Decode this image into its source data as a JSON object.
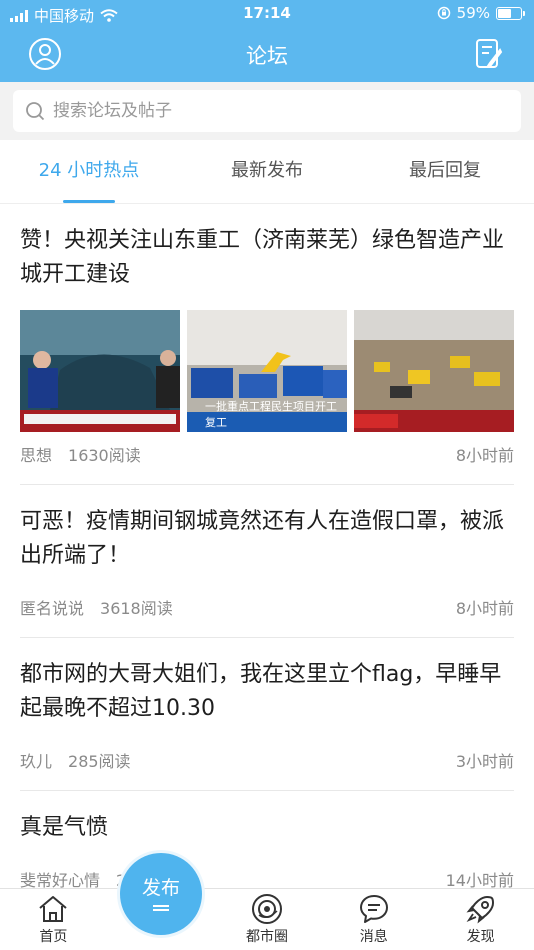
{
  "status": {
    "carrier": "中国移动",
    "time": "17:14",
    "battery": "59%",
    "battery_level": 0.59
  },
  "nav": {
    "title": "论坛",
    "left_icon": "user-circle-icon",
    "right_icon": "compose-icon"
  },
  "search": {
    "placeholder": "搜索论坛及帖子"
  },
  "tabs": [
    {
      "label": "24 小时热点",
      "active": true
    },
    {
      "label": "最新发布",
      "active": false
    },
    {
      "label": "最后回复",
      "active": false
    }
  ],
  "posts": [
    {
      "title": "赞！央视关注山东重工（济南莱芜）绿色智造产业城开工建设",
      "author": "思想",
      "reads": "1630阅读",
      "time": "8小时前",
      "image_captions": [
        "",
        "一批重点工程民生项目开工复工",
        ""
      ]
    },
    {
      "title": "可恶！疫情期间钢城竟然还有人在造假口罩，被派出所端了！",
      "author": "匿名说说",
      "reads": "3618阅读",
      "time": "8小时前"
    },
    {
      "title": "都市网的大哥大姐们，我在这里立个flag，早睡早起最晚不超过10.30",
      "author": "玖儿",
      "reads": "285阅读",
      "time": "3小时前"
    },
    {
      "title": "真是气愤",
      "author": "斐常好心情",
      "reads": "2 阅读",
      "time": "14小时前"
    }
  ],
  "tabbar": {
    "home": "首页",
    "publish": "发布",
    "circle": "都市圈",
    "messages": "消息",
    "discover": "发现"
  },
  "colors": {
    "primary": "#5cb8ef",
    "accent": "#3ea8ec"
  }
}
